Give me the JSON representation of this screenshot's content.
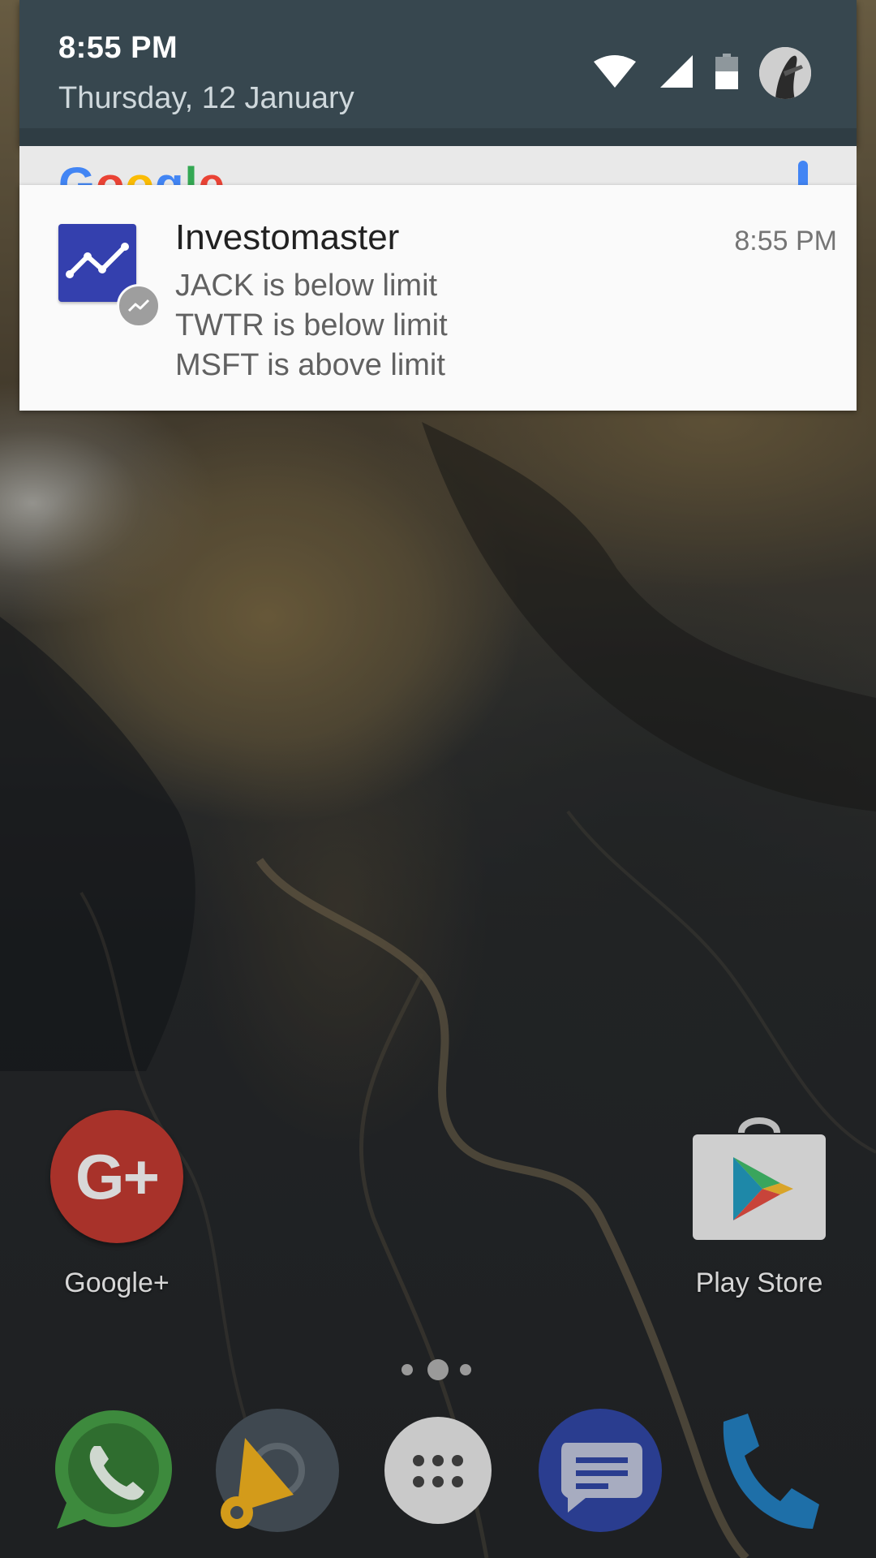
{
  "status_bar": {
    "time": "8:55 PM",
    "date": "Thursday, 12 January",
    "icons": [
      "wifi-icon",
      "signal-icon",
      "battery-icon",
      "avatar"
    ]
  },
  "google_bar": {
    "text": "Google"
  },
  "notification": {
    "app_name": "Investomaster",
    "time": "8:55 PM",
    "lines": [
      "JACK is below limit",
      "TWTR is below limit",
      "MSFT is above limit"
    ],
    "icon": "trending-up-icon",
    "accent": "#3440ae"
  },
  "home": {
    "apps": [
      {
        "label": "Google+",
        "icon": "google-plus-icon"
      },
      {
        "label": "Play Store",
        "icon": "play-store-icon"
      }
    ],
    "page_indicator": {
      "pages": 3,
      "current": 2
    }
  },
  "dock": {
    "apps": [
      "whatsapp-icon",
      "media-player-icon",
      "app-drawer-icon",
      "messages-icon",
      "phone-icon"
    ]
  }
}
